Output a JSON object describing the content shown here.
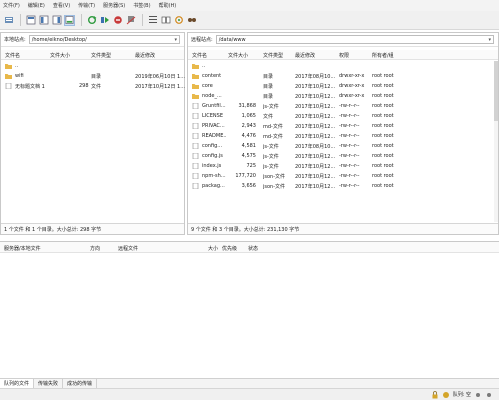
{
  "menu": [
    "文件(F)",
    "编辑(E)",
    "查看(V)",
    "传输(T)",
    "服务器(S)",
    "书签(B)",
    "帮助(H)"
  ],
  "toolbar": {
    "icons": [
      "site-manager-icon",
      "toggle-message-log-icon",
      "toggle-local-tree-icon",
      "toggle-remote-tree-icon",
      "refresh-icon",
      "process-queue-icon",
      "cancel-icon",
      "disconnect-icon",
      "reconnect-icon",
      "filter-icon",
      "compare-icon",
      "sync-browse-icon",
      "search-icon"
    ]
  },
  "local": {
    "addr_label": "本地站点:",
    "path": "/home/eikno/Desktop/",
    "columns": [
      "文件名",
      "文件大小",
      "文件类型",
      "最近修改"
    ],
    "rows": [
      {
        "name": "..",
        "size": "",
        "type": "",
        "modified": "",
        "icon": "folder"
      },
      {
        "name": "wifi",
        "size": "",
        "type": "目录",
        "modified": "2019年06月10日 1...",
        "icon": "folder"
      },
      {
        "name": "无标题文档 1",
        "size": "298",
        "type": "文件",
        "modified": "2017年10月12日 1...",
        "icon": "file"
      }
    ],
    "status": "1 个文件 和 1 个目录。大小总计: 298 字节"
  },
  "remote": {
    "addr_label": "远程站点:",
    "path": "/data/www",
    "columns": [
      "文件名",
      "文件大小",
      "文件类型",
      "最近修改",
      "权限",
      "所有者/组"
    ],
    "rows": [
      {
        "name": "..",
        "size": "",
        "type": "",
        "modified": "",
        "perm": "",
        "owner": "",
        "icon": "folder"
      },
      {
        "name": "content",
        "size": "",
        "type": "目录",
        "modified": "2017年08月10...",
        "perm": "drwxr-xr-x",
        "owner": "root root",
        "icon": "folder"
      },
      {
        "name": "core",
        "size": "",
        "type": "目录",
        "modified": "2017年10月12...",
        "perm": "drwxr-xr-x",
        "owner": "root root",
        "icon": "folder"
      },
      {
        "name": "node_...",
        "size": "",
        "type": "目录",
        "modified": "2017年10月12...",
        "perm": "drwxr-xr-x",
        "owner": "root root",
        "icon": "folder"
      },
      {
        "name": "Gruntfil...",
        "size": "31,868",
        "type": "js-文件",
        "modified": "2017年10月12...",
        "perm": "-rw-r--r--",
        "owner": "root root",
        "icon": "file"
      },
      {
        "name": "LICENSE",
        "size": "1,065",
        "type": "文件",
        "modified": "2017年10月12...",
        "perm": "-rw-r--r--",
        "owner": "root root",
        "icon": "file"
      },
      {
        "name": "PRIVAC...",
        "size": "2,943",
        "type": "md-文件",
        "modified": "2017年10月12...",
        "perm": "-rw-r--r--",
        "owner": "root root",
        "icon": "file"
      },
      {
        "name": "README...",
        "size": "4,476",
        "type": "md-文件",
        "modified": "2017年10月12...",
        "perm": "-rw-r--r--",
        "owner": "root root",
        "icon": "file"
      },
      {
        "name": "config...",
        "size": "4,581",
        "type": "js-文件",
        "modified": "2017年08月10...",
        "perm": "-rw-r--r--",
        "owner": "root root",
        "icon": "file"
      },
      {
        "name": "config.js",
        "size": "4,575",
        "type": "js-文件",
        "modified": "2017年10月12...",
        "perm": "-rw-r--r--",
        "owner": "root root",
        "icon": "file"
      },
      {
        "name": "index.js",
        "size": "725",
        "type": "js-文件",
        "modified": "2017年10月12...",
        "perm": "-rw-r--r--",
        "owner": "root root",
        "icon": "file"
      },
      {
        "name": "npm-sh...",
        "size": "177,720",
        "type": "json-文件",
        "modified": "2017年10月12...",
        "perm": "-rw-r--r--",
        "owner": "root root",
        "icon": "file"
      },
      {
        "name": "packag...",
        "size": "3,656",
        "type": "json-文件",
        "modified": "2017年10月12...",
        "perm": "-rw-r--r--",
        "owner": "root root",
        "icon": "file"
      }
    ],
    "status": "9 个文件 和 3 个目录。大小总计: 231,130 字节"
  },
  "queue": {
    "columns": [
      "服务器/本地文件",
      "方向",
      "远程文件",
      "大小",
      "优先级",
      "状态"
    ]
  },
  "tabs": [
    {
      "label": "队列的文件",
      "active": true
    },
    {
      "label": "传输失败",
      "active": false
    },
    {
      "label": "成功的传输",
      "active": false
    }
  ],
  "statusbar": {
    "queue_label": "队列: 空"
  },
  "colors": {
    "folder": "#e8b84a",
    "file": "#ffffff",
    "accent": "#2a7ad6"
  }
}
